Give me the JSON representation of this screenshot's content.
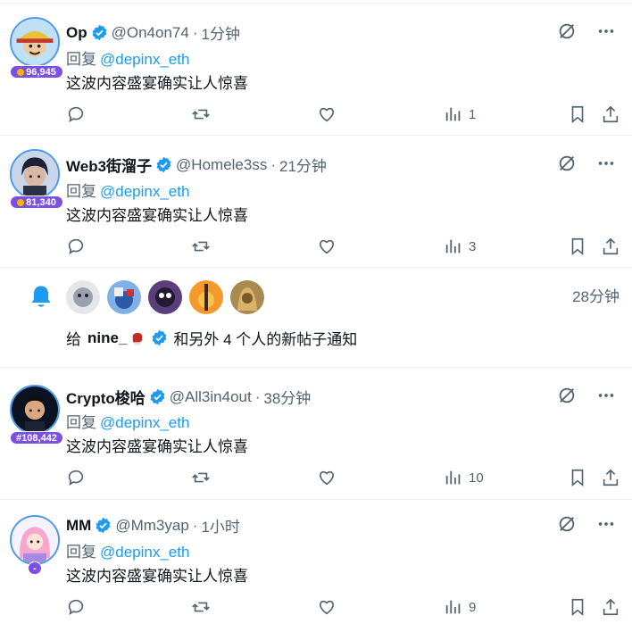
{
  "colors": {
    "accent": "#1d9bf0",
    "secondary": "#536471",
    "badge": "#7b4fe0"
  },
  "tweets": [
    {
      "name": "Op",
      "handle": "@On4on74",
      "time": "1分钟",
      "badge": "96,945",
      "reply_label": "回复",
      "mention": "@depinx_eth",
      "text": "这波内容盛宴确实让人惊喜",
      "views": "1"
    },
    {
      "name": "Web3街溜子",
      "handle": "@Homele3ss",
      "time": "21分钟",
      "badge": "81,340",
      "reply_label": "回复",
      "mention": "@depinx_eth",
      "text": "这波内容盛宴确实让人惊喜",
      "views": "3"
    },
    {
      "name": "Crypto梭哈",
      "handle": "@All3in4out",
      "time": "38分钟",
      "badge": "#108,442",
      "reply_label": "回复",
      "mention": "@depinx_eth",
      "text": "这波内容盛宴确实让人惊喜",
      "views": "10"
    },
    {
      "name": "MM",
      "handle": "@Mm3yap",
      "time": "1小时",
      "badge": "-",
      "reply_label": "回复",
      "mention": "@depinx_eth",
      "text": "这波内容盛宴确实让人惊喜",
      "views": "9"
    }
  ],
  "notification": {
    "time": "28分钟",
    "prefix": "给",
    "user": "nine_",
    "suffix": "和另外 4 个人的新帖子通知"
  },
  "icons": {
    "grok": "grok-icon",
    "more": "more-icon",
    "reply": "reply-icon",
    "repost": "repost-icon",
    "like": "like-icon",
    "views": "views-icon",
    "bookmark": "bookmark-icon",
    "share": "share-icon",
    "bell": "bell-icon",
    "verified": "verified-badge-icon",
    "glove": "boxing-glove-icon"
  }
}
